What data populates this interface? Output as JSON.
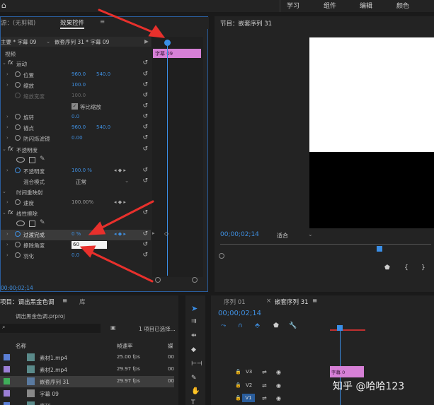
{
  "topbar": {
    "workspaces": [
      "学习",
      "组件",
      "编辑",
      "颜色"
    ]
  },
  "effect_controls": {
    "tab_source": "源：(无剪辑)",
    "tab_effect": "效果控件",
    "tab_menu": "≡",
    "source_label": "主要 * 字幕 09",
    "sequence_label": "嵌套序列 31 * 字幕 09",
    "time_start": "00",
    "time_end": "00",
    "section_video": "视频",
    "clip_name": "字幕 09",
    "rows": {
      "motion": "运动",
      "position": "位置",
      "position_x": "960.0",
      "position_y": "540.0",
      "scale": "缩放",
      "scale_v": "100.0",
      "scale_width": "缩放宽度",
      "scale_width_v": "100.0",
      "uniform_scale": "等比缩放",
      "rotation": "旋转",
      "rotation_v": "0.0",
      "anchor": "锚点",
      "anchor_x": "960.0",
      "anchor_y": "540.0",
      "antiflicker": "防闪烁滤镜",
      "antiflicker_v": "0.00",
      "opacity": "不透明度",
      "opacity_prop": "不透明度",
      "opacity_v": "100.0 %",
      "blend_mode": "混合模式",
      "blend_v": "正常",
      "time_remap": "时间重映射",
      "speed": "速度",
      "speed_v": "100.00%",
      "linear_wipe": "线性擦除",
      "transition_completion": "过渡完成",
      "transition_v": "0 %",
      "wipe_angle": "擦除角度",
      "wipe_angle_v": "60",
      "feather": "羽化",
      "feather_v": "0.0"
    },
    "timecode": "00:00;02;14"
  },
  "program_monitor": {
    "title": "节目：嵌套序列 31",
    "timecode": "00;00;02;14",
    "fit": "适合"
  },
  "project": {
    "tab": "项目：调出黑金色调",
    "tab2": "库",
    "file": "调出黑金色调.prproj",
    "selection": "1 项目已选择...",
    "col_name": "名称",
    "col_fps": "帧速率",
    "col_extra": "媒",
    "files": [
      {
        "name": "素材1.mp4",
        "fps": "25.00 fps",
        "extra": "00",
        "color": "#5b7fd6"
      },
      {
        "name": "素材2.mp4",
        "fps": "29.97 fps",
        "extra": "00",
        "color": "#9b7fd6"
      },
      {
        "name": "嵌套序列 31",
        "fps": "29.97 fps",
        "extra": "00",
        "color": "#3fae5a"
      },
      {
        "name": "字幕 09",
        "fps": "",
        "extra": "",
        "color": "#9b7fd6"
      },
      {
        "name": "序列",
        "fps": "",
        "extra": "",
        "color": "#5b7fd6"
      }
    ]
  },
  "sequence": {
    "tab1": "序列 01",
    "tab2": "嵌套序列 31",
    "timecode": "00;00;02;14",
    "tracks": [
      "V3",
      "V2",
      "V1"
    ],
    "clip_label": "字幕 0"
  },
  "watermark": "知乎 @哈哈123"
}
